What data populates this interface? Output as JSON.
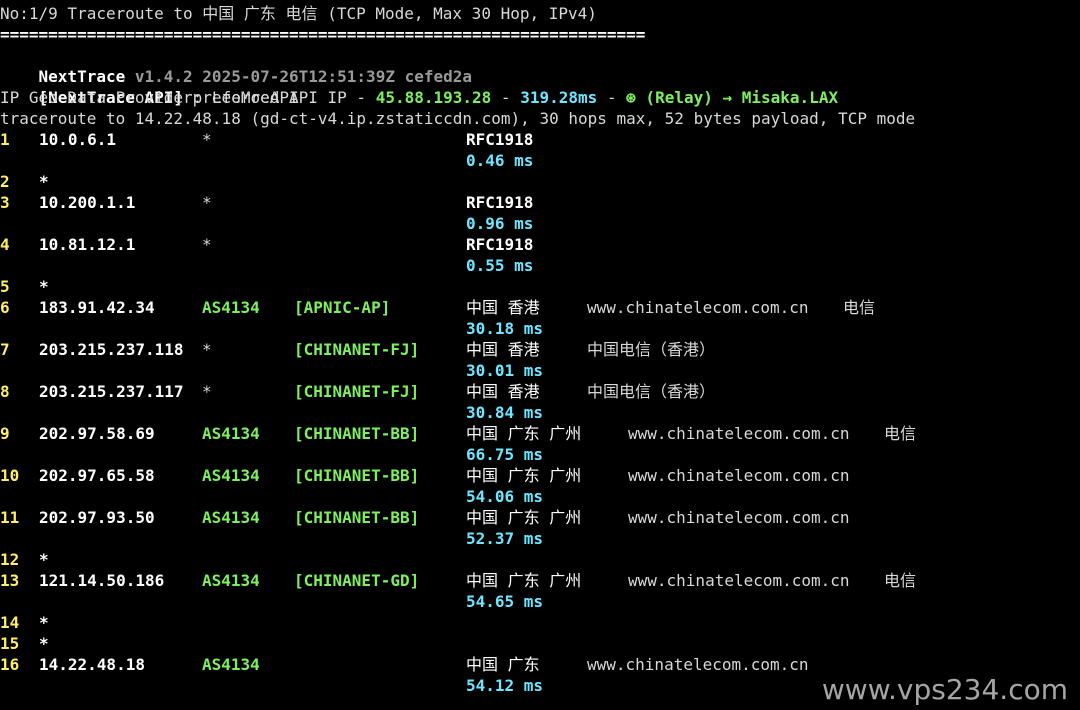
{
  "header": {
    "title_line": "No:1/9 Traceroute to 中国 广东 电信 (TCP Mode, Max 30 Hop, IPv4)",
    "separator": "===================================================================",
    "app_name": "NextTrace",
    "app_meta": " v1.4.2 2025-07-26T12:51:39Z cefed2a",
    "api_label": "[NextTrace API]",
    "api_text": " preferred API IP - ",
    "api_ip": "45.88.193.28",
    "api_dash1": " - ",
    "api_latency": "319.28ms",
    "api_dash2": " - ",
    "api_relay_icon": "⊛",
    "api_relay": " (Relay) → Misaka.LAX",
    "geo_provider": "IP Geo Data Provider: LeoMoeAPI",
    "traceroute_line": "traceroute to 14.22.48.18 (gd-ct-v4.ip.zstaticcdn.com), 30 hops max, 52 bytes payload, TCP mode"
  },
  "hops": [
    {
      "num": "1",
      "ip": "10.0.6.1",
      "as": "*",
      "tag": "",
      "geo": "RFC1918",
      "domain": "",
      "isp": "",
      "ms": "0.46 ms"
    },
    {
      "num": "2",
      "ip": "*"
    },
    {
      "num": "3",
      "ip": "10.200.1.1",
      "as": "*",
      "tag": "",
      "geo": "RFC1918",
      "domain": "",
      "isp": "",
      "ms": "0.96 ms"
    },
    {
      "num": "4",
      "ip": "10.81.12.1",
      "as": "*",
      "tag": "",
      "geo": "RFC1918",
      "domain": "",
      "isp": "",
      "ms": "0.55 ms"
    },
    {
      "num": "5",
      "ip": "*"
    },
    {
      "num": "6",
      "ip": "183.91.42.34",
      "as": "AS4134",
      "tag": "[APNIC-AP]",
      "geo": "中国 香港",
      "domain": "www.chinatelecom.com.cn",
      "isp": "电信",
      "ms": "30.18 ms"
    },
    {
      "num": "7",
      "ip": "203.215.237.118",
      "as": "*",
      "tag": "[CHINANET-FJ]",
      "geo": "中国 香港",
      "domain": "中国电信（香港）",
      "isp": "",
      "ms": "30.01 ms"
    },
    {
      "num": "8",
      "ip": "203.215.237.117",
      "as": "*",
      "tag": "[CHINANET-FJ]",
      "geo": "中国 香港",
      "domain": "中国电信（香港）",
      "isp": "",
      "ms": "30.84 ms"
    },
    {
      "num": "9",
      "ip": "202.97.58.69",
      "as": "AS4134",
      "tag": "[CHINANET-BB]",
      "geo": "中国 广东 广州",
      "domain": "www.chinatelecom.com.cn",
      "isp": "电信",
      "ms": "66.75 ms"
    },
    {
      "num": "10",
      "ip": "202.97.65.58",
      "as": "AS4134",
      "tag": "[CHINANET-BB]",
      "geo": "中国 广东 广州",
      "domain": "www.chinatelecom.com.cn",
      "isp": "",
      "ms": "54.06 ms"
    },
    {
      "num": "11",
      "ip": "202.97.93.50",
      "as": "AS4134",
      "tag": "[CHINANET-BB]",
      "geo": "中国 广东 广州",
      "domain": "www.chinatelecom.com.cn",
      "isp": "",
      "ms": "52.37 ms"
    },
    {
      "num": "12",
      "ip": "*"
    },
    {
      "num": "13",
      "ip": "121.14.50.186",
      "as": "AS4134",
      "tag": "[CHINANET-GD]",
      "geo": "中国 广东 广州",
      "domain": "www.chinatelecom.com.cn",
      "isp": "电信",
      "ms": "54.65 ms"
    },
    {
      "num": "14",
      "ip": "*"
    },
    {
      "num": "15",
      "ip": "*"
    },
    {
      "num": "16",
      "ip": "14.22.48.18",
      "as": "AS4134",
      "tag": "",
      "geo": "中国 广东",
      "domain": "www.chinatelecom.com.cn",
      "isp": "",
      "ms": "54.12 ms"
    }
  ],
  "watermark": "www.vps234.com",
  "colors": {
    "background": "#000000",
    "hop_number": "#ffee66",
    "asn_green": "#7ef05f",
    "latency_cyan": "#6fe6ff",
    "text_white": "#ffffff"
  }
}
